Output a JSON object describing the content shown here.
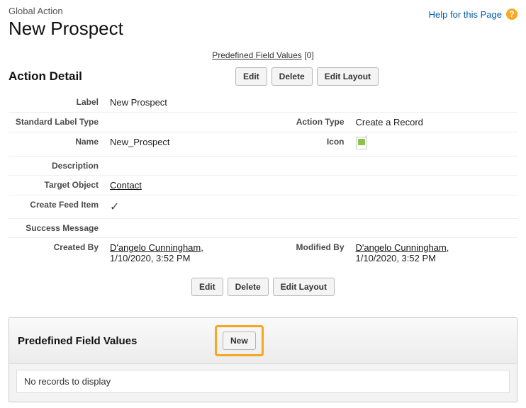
{
  "header": {
    "super_title": "Global Action",
    "title": "New Prospect",
    "help_label": "Help for this Page"
  },
  "top_nav": {
    "predefined_link": "Predefined Field Values",
    "predefined_count": "[0]"
  },
  "section": {
    "title": "Action Detail",
    "edit": "Edit",
    "delete": "Delete",
    "edit_layout": "Edit Layout"
  },
  "fields": {
    "label_label": "Label",
    "label_value": "New Prospect",
    "std_label_type_label": "Standard Label Type",
    "std_label_type_value": "",
    "action_type_label": "Action Type",
    "action_type_value": "Create a Record",
    "name_label": "Name",
    "name_value": "New_Prospect",
    "icon_label": "Icon",
    "description_label": "Description",
    "description_value": "",
    "target_object_label": "Target Object",
    "target_object_value": "Contact",
    "create_feed_label": "Create Feed Item",
    "success_msg_label": "Success Message",
    "success_msg_value": "",
    "created_by_label": "Created By",
    "created_by_name": "D'angelo Cunningham",
    "created_by_date": "1/10/2020, 3:52 PM",
    "modified_by_label": "Modified By",
    "modified_by_name": "D'angelo Cunningham",
    "modified_by_date": "1/10/2020, 3:52 PM"
  },
  "related": {
    "title": "Predefined Field Values",
    "new": "New",
    "empty": "No records to display"
  }
}
